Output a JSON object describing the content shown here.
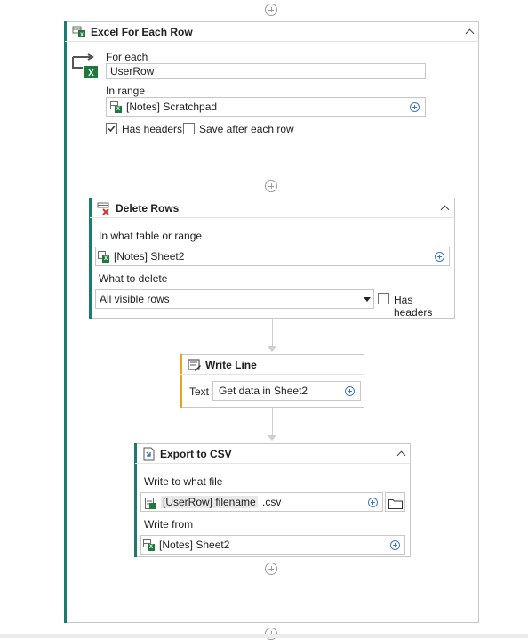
{
  "colors": {
    "accent_green": "#1e7a6e",
    "accent_orange": "#e8a21c",
    "excel_green": "#1e7a3c",
    "delete_red": "#d9302c",
    "plus_blue": "#3c78c8"
  },
  "foreach": {
    "title": "Excel For Each Row",
    "for_each_label": "For each",
    "for_each_value": "UserRow",
    "range_label": "In range",
    "range_value": "[Notes] Scratchpad",
    "has_headers_label": "Has headers",
    "has_headers_checked": true,
    "save_label": "Save after each row",
    "save_checked": false
  },
  "delete_rows": {
    "title": "Delete Rows",
    "table_label": "In what table or range",
    "table_value": "[Notes] Sheet2",
    "what_label": "What to delete",
    "what_value": "All visible rows",
    "has_headers_label": "Has headers",
    "has_headers_checked": false
  },
  "write_line": {
    "title": "Write Line",
    "text_label": "Text",
    "text_value": "Get data in Sheet2"
  },
  "export_csv": {
    "title": "Export to CSV",
    "file_label": "Write to what file",
    "file_var": "[UserRow] filename",
    "file_suffix": ".csv",
    "from_label": "Write from",
    "from_value": "[Notes] Sheet2"
  }
}
